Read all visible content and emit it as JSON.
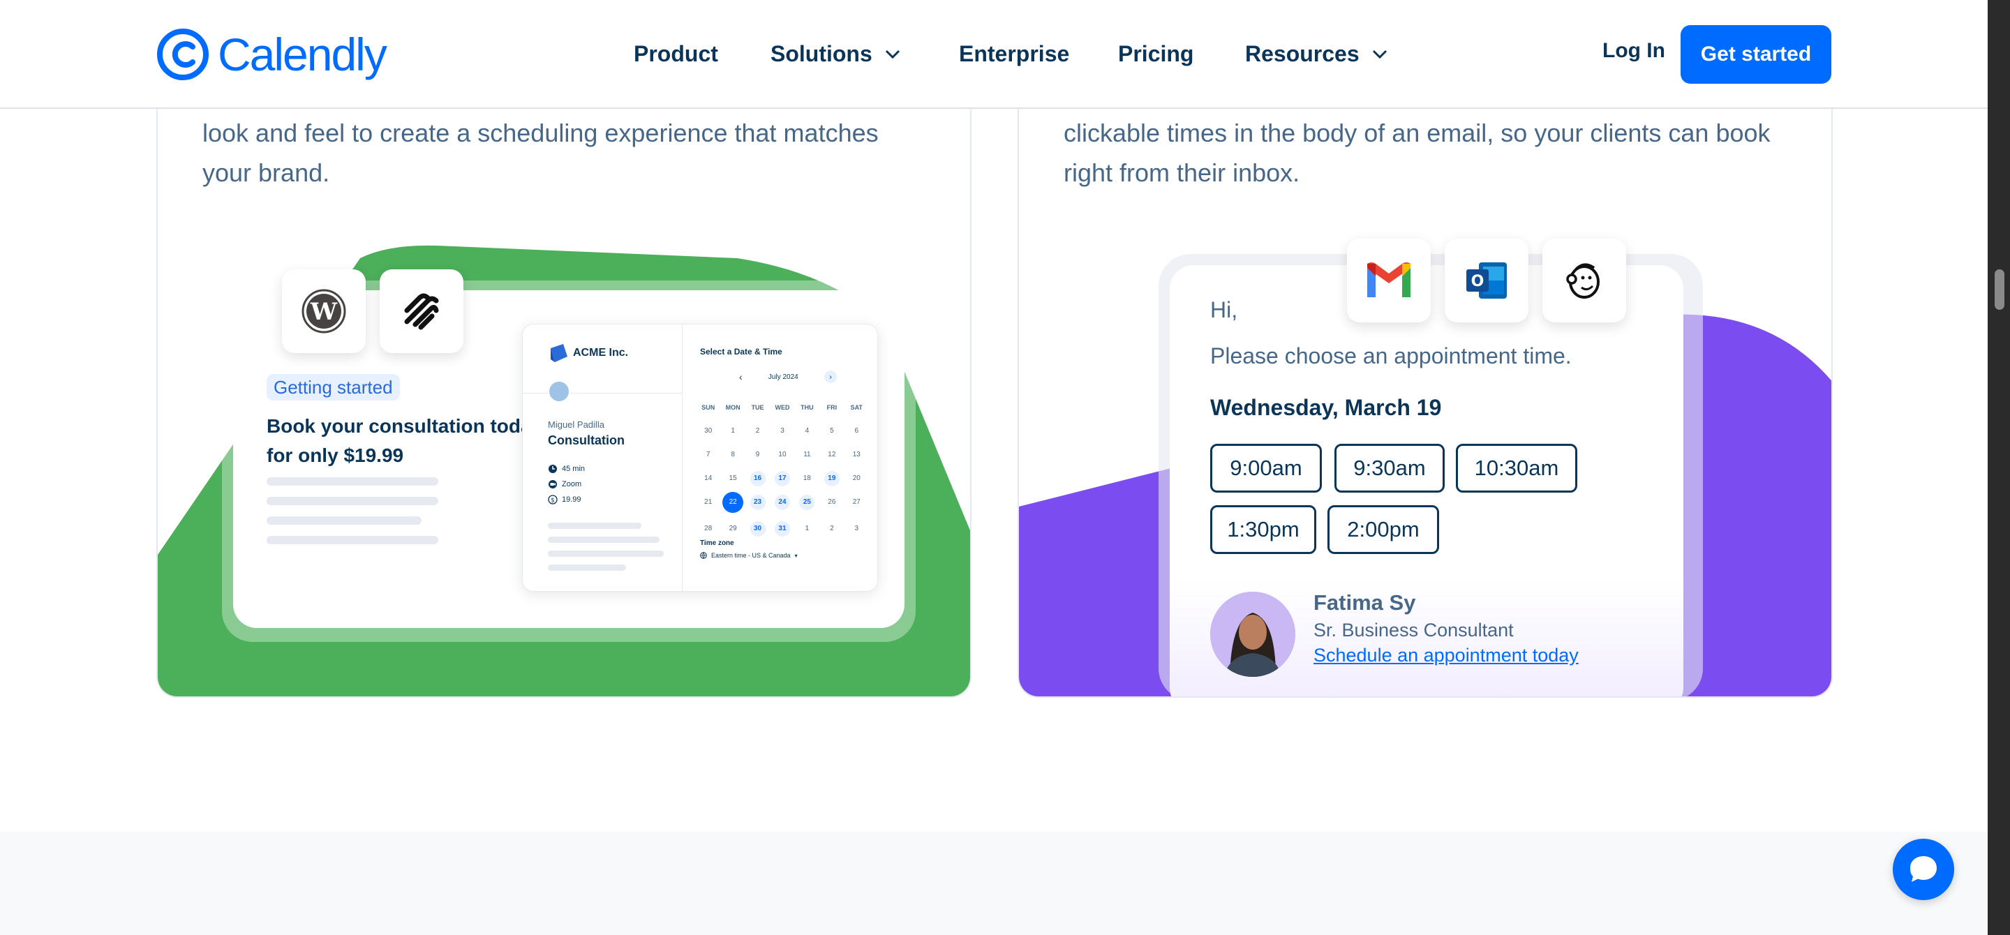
{
  "header": {
    "logo_text": "Calendly",
    "nav": [
      {
        "label": "Product",
        "has_dropdown": false
      },
      {
        "label": "Solutions",
        "has_dropdown": true
      },
      {
        "label": "Enterprise",
        "has_dropdown": false
      },
      {
        "label": "Pricing",
        "has_dropdown": false
      },
      {
        "label": "Resources",
        "has_dropdown": true
      }
    ],
    "login_label": "Log In",
    "cta_label": "Get started"
  },
  "card_branding": {
    "description": "look and feel to create a scheduling experience that matches your brand.",
    "icons": [
      "wordpress-icon",
      "squarespace-icon"
    ],
    "badge": "Getting started",
    "headline": "Book your consultation today for only $19.99",
    "widget": {
      "company": "ACME Inc.",
      "host": "Miguel Padilla",
      "event": "Consultation",
      "duration": "45 min",
      "location": "Zoom",
      "price": "19.99",
      "picker_title": "Select a Date & Time",
      "month": "July 2024",
      "weekdays": [
        "SUN",
        "MON",
        "TUE",
        "WED",
        "THU",
        "FRI",
        "SAT"
      ],
      "days": [
        [
          "30",
          "1",
          "2",
          "3",
          "4",
          "5",
          "6"
        ],
        [
          "7",
          "8",
          "9",
          "10",
          "11",
          "12",
          "13"
        ],
        [
          "14",
          "15",
          "16",
          "17",
          "18",
          "19",
          "20"
        ],
        [
          "21",
          "22",
          "23",
          "24",
          "25",
          "26",
          "27"
        ],
        [
          "28",
          "29",
          "30",
          "31",
          "1",
          "2",
          "3"
        ]
      ],
      "available_days": [
        "16",
        "17",
        "19",
        "23",
        "24",
        "25",
        "30",
        "31"
      ],
      "selected_day": "22",
      "timezone_label": "Time zone",
      "timezone_value": "Eastern time - US & Canada"
    },
    "accent_color": "#4caf5a"
  },
  "card_email": {
    "description": "clickable times in the body of an email, so your clients can book right from their inbox.",
    "icons": [
      "gmail-icon",
      "outlook-icon",
      "mailchimp-icon"
    ],
    "greeting": "Hi,",
    "prompt": "Please choose an appointment time.",
    "date": "Wednesday, March 19",
    "times_row1": [
      "9:00am",
      "9:30am",
      "10:30am"
    ],
    "times_row2": [
      "1:30pm",
      "2:00pm"
    ],
    "person_name": "Fatima Sy",
    "person_title": "Sr. Business Consultant",
    "link_text": "Schedule an appointment today",
    "accent_color": "#7b4cf0"
  },
  "chat_icon": "chat-bubble-icon"
}
